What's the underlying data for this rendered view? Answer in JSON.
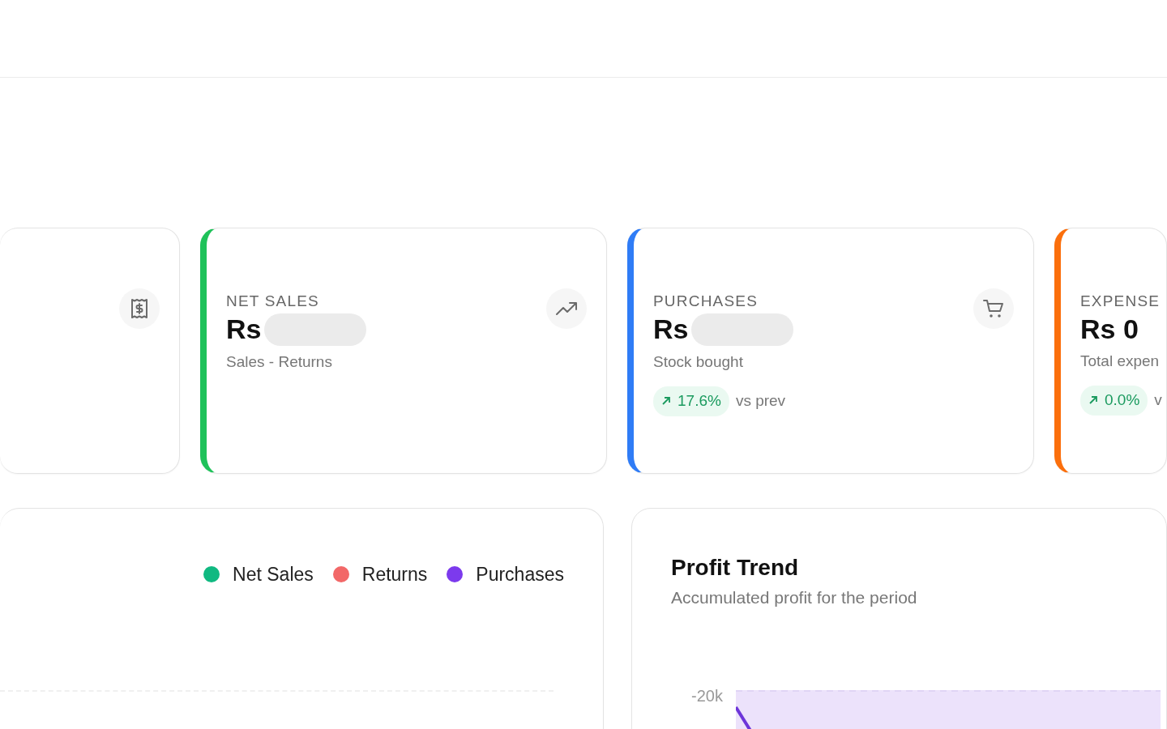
{
  "stat_cards": [
    {
      "kind": "receipt"
    },
    {
      "label": "NET SALES",
      "value": "Rs",
      "masked": true,
      "note": "Sales - Returns",
      "color": "#1fc25a",
      "kind": "trend"
    },
    {
      "label": "PURCHASES",
      "value": "Rs",
      "masked": true,
      "note": "Stock bought",
      "change": "17.6%",
      "change_note": "vs prev",
      "color": "#2f7cf6",
      "kind": "cart"
    },
    {
      "label": "EXPENSE",
      "value": "Rs 0",
      "masked": false,
      "note": "Total expen",
      "change": "0.0%",
      "change_note": "v",
      "color": "#fb6f0c"
    }
  ],
  "sales_panel": {
    "legend": [
      {
        "label": "Net Sales",
        "color": "#10b981"
      },
      {
        "label": "Returns",
        "color": "#f26868"
      },
      {
        "label": "Purchases",
        "color": "#7c3aed"
      }
    ]
  },
  "profit_panel": {
    "title": "Profit Trend",
    "subtitle": "Accumulated profit for the period",
    "y_tick": "-20k"
  }
}
